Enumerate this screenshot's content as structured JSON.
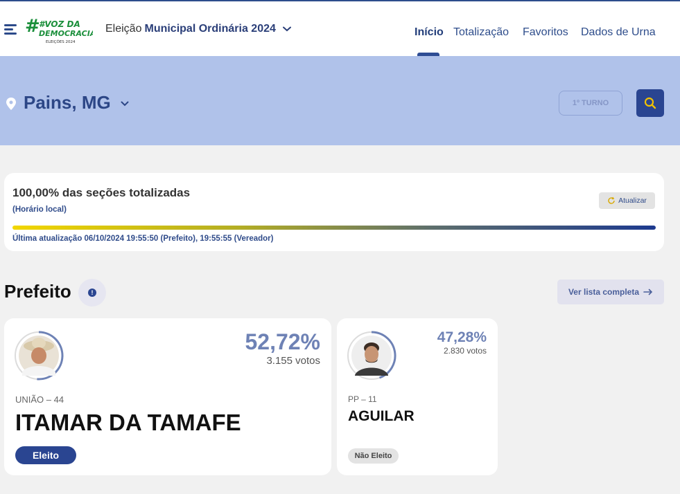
{
  "header": {
    "logo_text": [
      "#VOZ DA",
      "DEMOCRACIA",
      "ELEIÇÕES 2024"
    ],
    "election_prefix": "Eleição",
    "election_name": "Municipal Ordinária 2024",
    "nav": [
      "Início",
      "Totalização",
      "Favoritos",
      "Dados de Urna"
    ],
    "active_nav": "Início"
  },
  "location": {
    "city": "Pains, MG",
    "turno_label": "1º TURNO"
  },
  "status": {
    "percent_text": "100,00% das seções totalizadas",
    "local_time_label": "(Horário local)",
    "refresh_label": "Atualizar",
    "progress_fraction": 1.0,
    "last_update": "Última atualização 06/10/2024 19:55:50 (Prefeito), 19:55:55 (Vereador)"
  },
  "section": {
    "title": "Prefeito",
    "list_button_label": "Ver lista completa"
  },
  "candidates": [
    {
      "party": "UNIÃO – 44",
      "name": "ITAMAR DA TAMAFE",
      "percent": "52,72%",
      "percent_value": 52.72,
      "votes": "3.155 votos",
      "status": "Eleito"
    },
    {
      "party": "PP – 11",
      "name": "AGUILAR",
      "percent": "47,28%",
      "percent_value": 47.28,
      "votes": "2.830 votos",
      "status": "Não Eleito"
    }
  ],
  "colors": {
    "primary": "#2a4591",
    "band": "#b0c2ea",
    "percent": "#6e82b5"
  }
}
